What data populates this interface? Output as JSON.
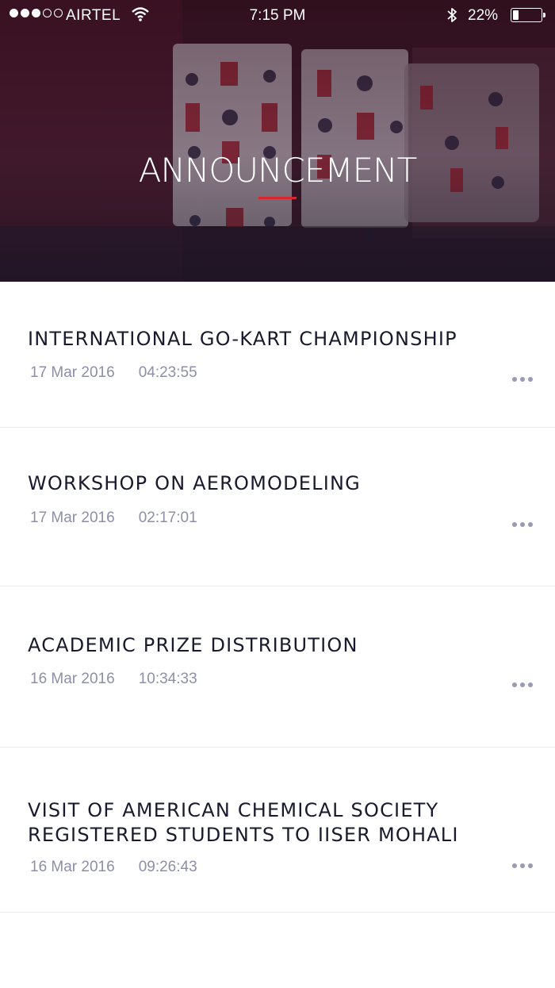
{
  "status_bar": {
    "carrier": "AIRTEL",
    "time": "7:15 PM",
    "battery_percent": "22%",
    "battery_level": 0.22,
    "signal_bars": 3,
    "signal_total": 5
  },
  "header": {
    "title": "ANNOUNCEMENT",
    "accent_color": "#d7262e"
  },
  "announcements": [
    {
      "title": "INTERNATIONAL GO-KART CHAMPIONSHIP",
      "date": "17 Mar 2016",
      "time": "04:23:55"
    },
    {
      "title": "WORKSHOP ON AEROMODELING",
      "date": "17 Mar 2016",
      "time": "02:17:01"
    },
    {
      "title": "ACADEMIC PRIZE DISTRIBUTION",
      "date": "16 Mar 2016",
      "time": "10:34:33"
    },
    {
      "title": "VISIT OF AMERICAN CHEMICAL SOCIETY REGISTERED STUDENTS TO IISER MOHALI",
      "date": "16 Mar 2016",
      "time": "09:26:43"
    }
  ],
  "icons": {
    "wifi": "wifi-icon",
    "bluetooth": "bluetooth-icon",
    "battery": "battery-icon",
    "more": "more-horizontal-icon"
  }
}
